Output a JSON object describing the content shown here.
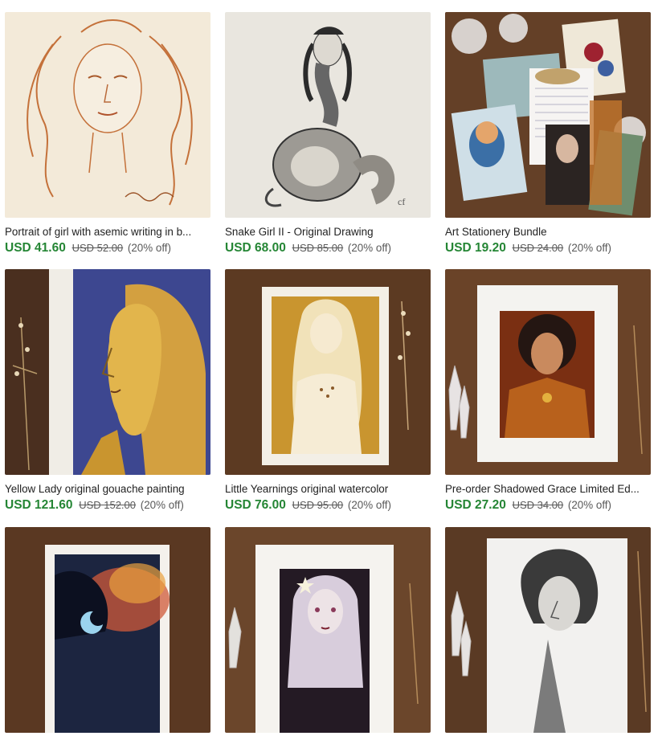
{
  "listings": [
    {
      "title": "Portrait of girl with asemic writing in b...",
      "price": "USD 41.60",
      "original_price": "USD 52.00",
      "discount": "(20% off)"
    },
    {
      "title": "Snake Girl II - Original Drawing",
      "price": "USD 68.00",
      "original_price": "USD 85.00",
      "discount": "(20% off)"
    },
    {
      "title": "Art Stationery Bundle",
      "price": "USD 19.20",
      "original_price": "USD 24.00",
      "discount": "(20% off)"
    },
    {
      "title": "Yellow Lady original gouache painting",
      "price": "USD 121.60",
      "original_price": "USD 152.00",
      "discount": "(20% off)"
    },
    {
      "title": "Little Yearnings original watercolor",
      "price": "USD 76.00",
      "original_price": "USD 95.00",
      "discount": "(20% off)"
    },
    {
      "title": "Pre-order Shadowed Grace Limited Ed...",
      "price": "USD 27.20",
      "original_price": "USD 34.00",
      "discount": "(20% off)"
    },
    {
      "title": "",
      "price": "",
      "original_price": "",
      "discount": ""
    },
    {
      "title": "",
      "price": "",
      "original_price": "",
      "discount": ""
    },
    {
      "title": "",
      "price": "",
      "original_price": "",
      "discount": ""
    }
  ],
  "colors": {
    "price": "#258635",
    "muted": "#595959",
    "text": "#222222"
  }
}
